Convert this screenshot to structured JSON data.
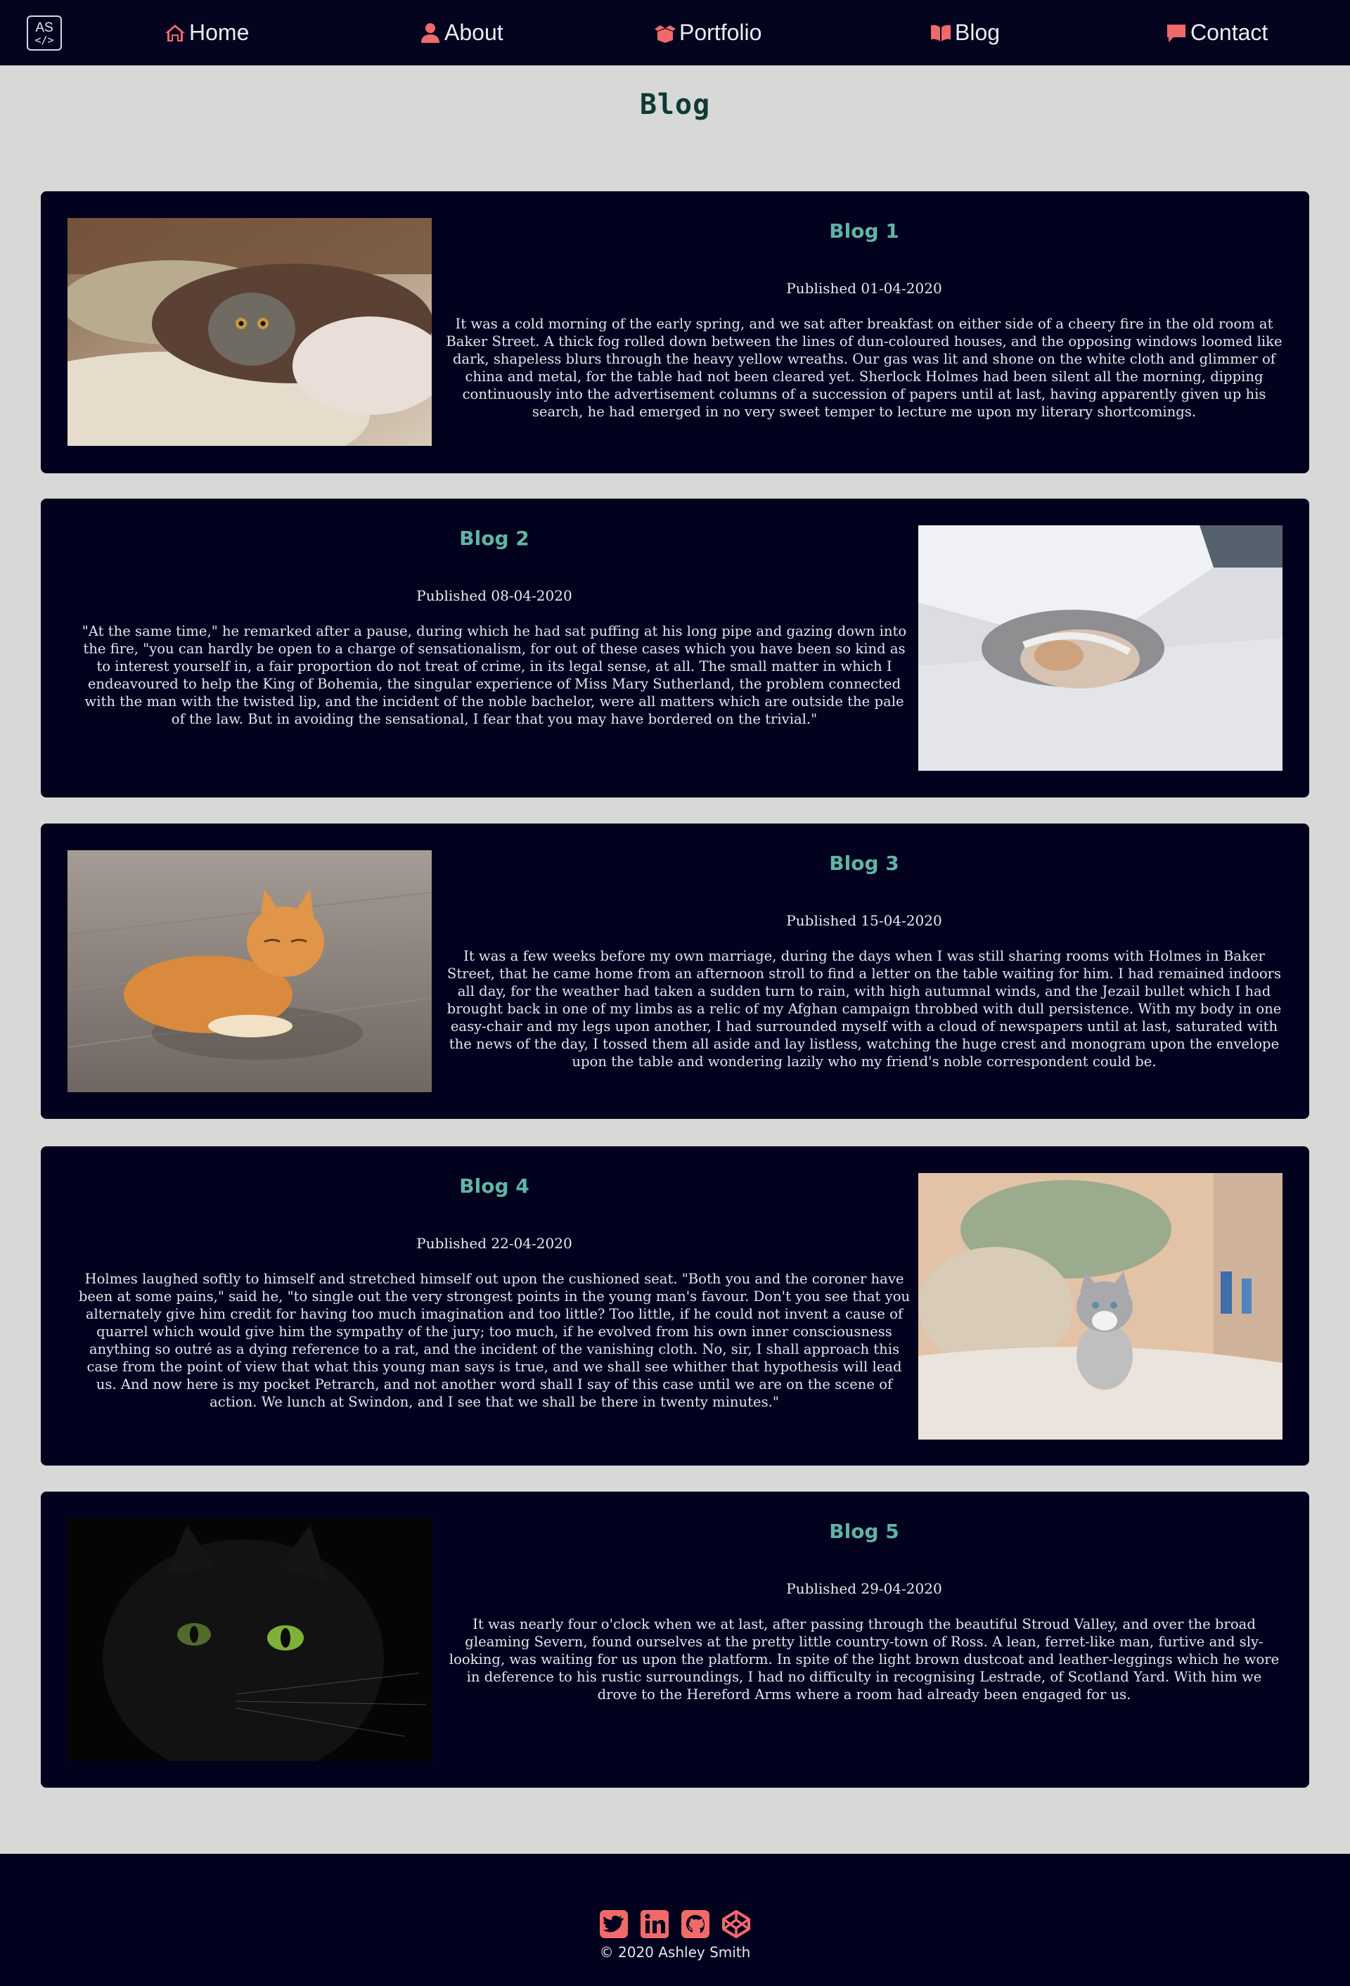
{
  "nav": {
    "logo_top": "AS",
    "logo_bottom": "</>",
    "items": [
      {
        "label": "Home",
        "icon": "home-icon"
      },
      {
        "label": "About",
        "icon": "user-icon"
      },
      {
        "label": "Portfolio",
        "icon": "box-open-icon"
      },
      {
        "label": "Blog",
        "icon": "book-open-icon"
      },
      {
        "label": "Contact",
        "icon": "comment-icon"
      }
    ]
  },
  "page_title": "Blog",
  "posts": [
    {
      "title": "Blog 1",
      "date": "Published 01-04-2020",
      "image": "cat-under-blanket-photo",
      "body": "It was a cold morning of the early spring, and we sat after breakfast on either side of a cheery fire in the old room at Baker Street. A thick fog rolled down between the lines of dun-coloured houses, and the opposing windows loomed like dark, shapeless blurs through the heavy yellow wreaths. Our gas was lit and shone on the white cloth and glimmer of china and metal, for the table had not been cleared yet. Sherlock Holmes had been silent all the morning, dipping continuously into the advertisement columns of a succession of papers until at last, having apparently given up his search, he had emerged in no very sweet temper to lecture me upon my literary shortcomings."
    },
    {
      "title": "Blog 2",
      "date": "Published 08-04-2020",
      "image": "sleeping-kitten-in-sheets-photo",
      "body": "\"At the same time,\" he remarked after a pause, during which he had sat puffing at his long pipe and gazing down into the fire, \"you can hardly be open to a charge of sensationalism, for out of these cases which you have been so kind as to interest yourself in, a fair proportion do not treat of crime, in its legal sense, at all. The small matter in which I endeavoured to help the King of Bohemia, the singular experience of Miss Mary Sutherland, the problem connected with the man with the twisted lip, and the incident of the noble bachelor, were all matters which are outside the pale of the law. But in avoiding the sensational, I fear that you may have bordered on the trivial.\""
    },
    {
      "title": "Blog 3",
      "date": "Published 15-04-2020",
      "image": "orange-tabby-cat-photo",
      "body": "It was a few weeks before my own marriage, during the days when I was still sharing rooms with Holmes in Baker Street, that he came home from an afternoon stroll to find a letter on the table waiting for him. I had remained indoors all day, for the weather had taken a sudden turn to rain, with high autumnal winds, and the Jezail bullet which I had brought back in one of my limbs as a relic of my Afghan campaign throbbed with dull persistence. With my body in one easy-chair and my legs upon another, I had surrounded myself with a cloud of newspapers until at last, saturated with the news of the day, I tossed them all aside and lay listless, watching the huge crest and monogram upon the envelope upon the table and wondering lazily who my friend's noble correspondent could be."
    },
    {
      "title": "Blog 4",
      "date": "Published 22-04-2020",
      "image": "grey-white-kitten-on-bed-photo",
      "body": "Holmes laughed softly to himself and stretched himself out upon the cushioned seat. \"Both you and the coroner have been at some pains,\" said he, \"to single out the very strongest points in the young man's favour. Don't you see that you alternately give him credit for having too much imagination and too little? Too little, if he could not invent a cause of quarrel which would give him the sympathy of the jury; too much, if he evolved from his own inner consciousness anything so outré as a dying reference to a rat, and the incident of the vanishing cloth. No, sir, I shall approach this case from the point of view that what this young man says is true, and we shall see whither that hypothesis will lead us. And now here is my pocket Petrarch, and not another word shall I say of this case until we are on the scene of action. We lunch at Swindon, and I see that we shall be there in twenty minutes.\""
    },
    {
      "title": "Blog 5",
      "date": "Published 29-04-2020",
      "image": "black-cat-green-eyes-photo",
      "body": "It was nearly four o'clock when we at last, after passing through the beautiful Stroud Valley, and over the broad gleaming Severn, found ourselves at the pretty little country-town of Ross. A lean, ferret-like man, furtive and sly-looking, was waiting for us upon the platform. In spite of the light brown dustcoat and leather-leggings which he wore in deference to his rustic surroundings, I had no difficulty in recognising Lestrade, of Scotland Yard. With him we drove to the Hereford Arms where a room had already been engaged for us."
    }
  ],
  "footer": {
    "social": [
      "twitter-icon",
      "linkedin-icon",
      "github-icon",
      "codepen-icon"
    ],
    "copyright": "© 2020 Ashley Smith"
  },
  "colors": {
    "nav_bg": "#05041f",
    "card_bg": "#03021e",
    "page_bg": "#d8d8d6",
    "accent": "#f06a6a",
    "heading": "#5fb5a5"
  }
}
